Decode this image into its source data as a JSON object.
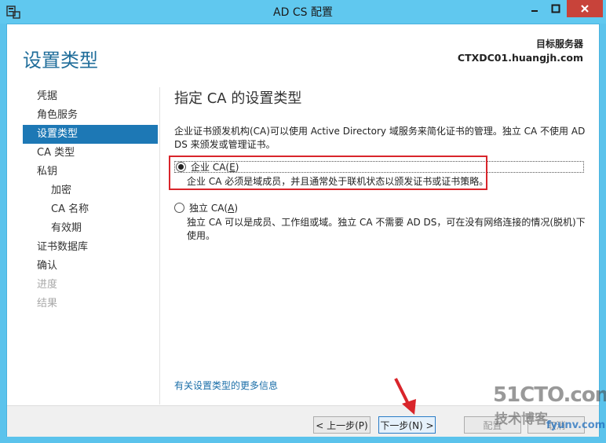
{
  "window": {
    "title": "AD CS 配置"
  },
  "header": {
    "page_title": "设置类型",
    "server_label": "目标服务器",
    "server_name": "CTXDC01.huangjh.com"
  },
  "sidebar": {
    "items": [
      {
        "label": "凭据",
        "level": 0,
        "state": "normal"
      },
      {
        "label": "角色服务",
        "level": 0,
        "state": "normal"
      },
      {
        "label": "设置类型",
        "level": 0,
        "state": "active"
      },
      {
        "label": "CA 类型",
        "level": 0,
        "state": "normal"
      },
      {
        "label": "私钥",
        "level": 0,
        "state": "normal"
      },
      {
        "label": "加密",
        "level": 1,
        "state": "normal"
      },
      {
        "label": "CA 名称",
        "level": 1,
        "state": "normal"
      },
      {
        "label": "有效期",
        "level": 1,
        "state": "normal"
      },
      {
        "label": "证书数据库",
        "level": 0,
        "state": "normal"
      },
      {
        "label": "确认",
        "level": 0,
        "state": "normal"
      },
      {
        "label": "进度",
        "level": 0,
        "state": "disabled"
      },
      {
        "label": "结果",
        "level": 0,
        "state": "disabled"
      }
    ]
  },
  "main": {
    "heading": "指定 CA 的设置类型",
    "description": "企业证书颁发机构(CA)可以使用 Active Directory 域服务来简化证书的管理。独立 CA 不使用 AD DS 来颁发或管理证书。",
    "options": {
      "enterprise": {
        "label_prefix": "企业 CA(",
        "label_key": "E",
        "label_suffix": ")",
        "description": "企业 CA 必须是域成员，并且通常处于联机状态以颁发证书或证书策略。",
        "selected": true
      },
      "standalone": {
        "label_prefix": "独立 CA(",
        "label_key": "A",
        "label_suffix": ")",
        "description": "独立 CA 可以是成员、工作组或域。独立 CA 不需要 AD DS，可在没有网络连接的情况(脱机)下使用。",
        "selected": false
      }
    },
    "more_link": "有关设置类型的更多信息"
  },
  "footer": {
    "prev_label": "< 上一步(P)",
    "next_label": "下一步(N) >",
    "config_label": "配置",
    "cancel_label": "取消"
  },
  "watermark": {
    "main": "51CTO.com",
    "sub": "技术博客",
    "url": "fyunv.com"
  },
  "colors": {
    "accent": "#1d78b5",
    "title_bar": "#60c8ef",
    "close_button": "#c8433a",
    "highlight": "#d9252b",
    "link": "#1a6ea8"
  }
}
